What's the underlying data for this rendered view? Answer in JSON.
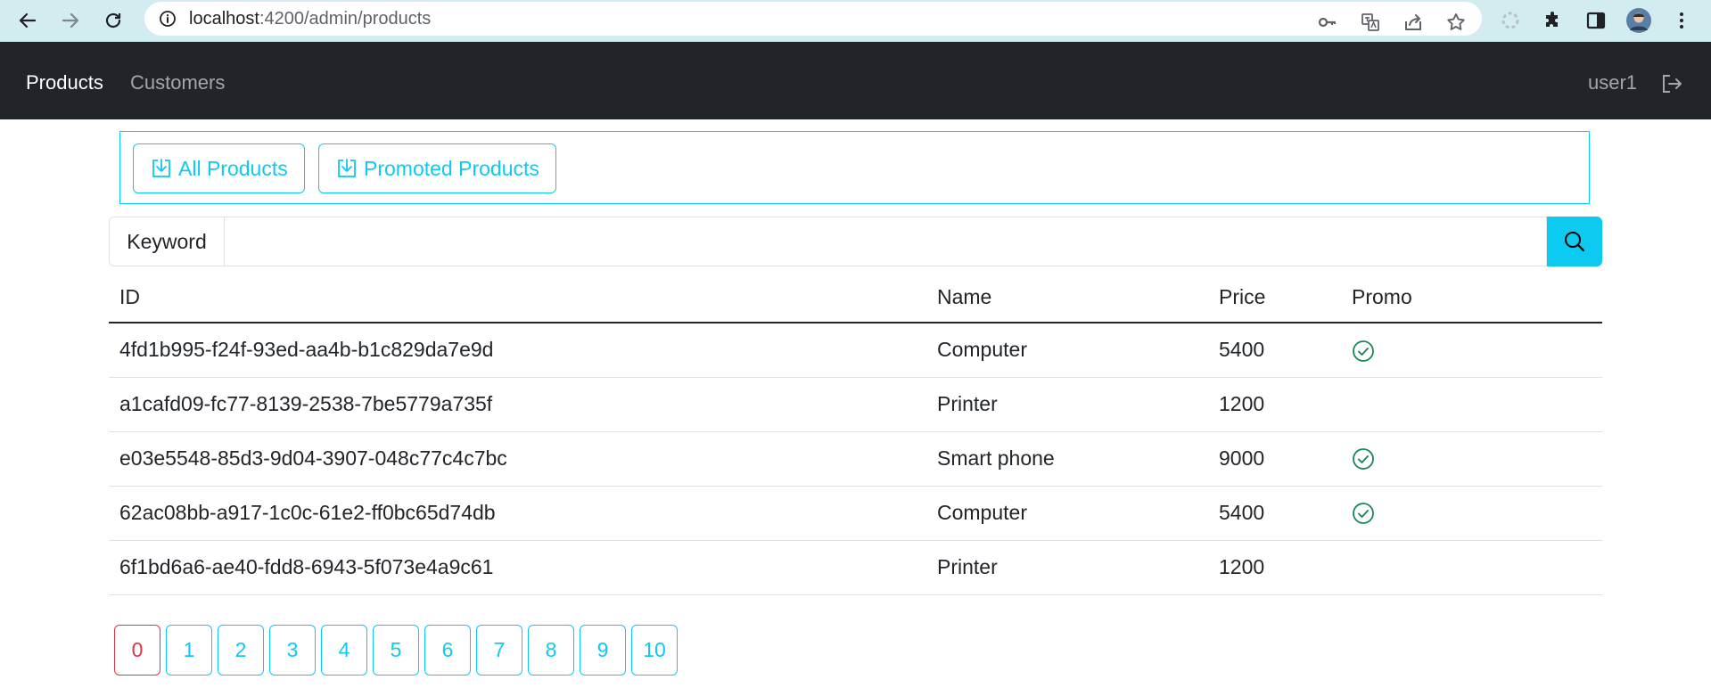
{
  "browser": {
    "url_host": "localhost",
    "url_rest": ":4200/admin/products"
  },
  "navbar": {
    "links": [
      {
        "label": "Products",
        "active": true
      },
      {
        "label": "Customers",
        "active": false
      }
    ],
    "user": "user1"
  },
  "filter": {
    "all_products_label": "All Products",
    "promoted_products_label": "Promoted Products"
  },
  "search": {
    "label": "Keyword",
    "value": "",
    "placeholder": ""
  },
  "table": {
    "headers": [
      "ID",
      "Name",
      "Price",
      "Promo"
    ],
    "rows": [
      {
        "id": "4fd1b995-f24f-93ed-aa4b-b1c829da7e9d",
        "name": "Computer",
        "price": "5400",
        "promo": true
      },
      {
        "id": "a1cafd09-fc77-8139-2538-7be5779a735f",
        "name": "Printer",
        "price": "1200",
        "promo": false
      },
      {
        "id": "e03e5548-85d3-9d04-3907-048c77c4c7bc",
        "name": "Smart phone",
        "price": "9000",
        "promo": true
      },
      {
        "id": "62ac08bb-a917-1c0c-61e2-ff0bc65d74db",
        "name": "Computer",
        "price": "5400",
        "promo": true
      },
      {
        "id": "6f1bd6a6-ae40-fdd8-6943-5f073e4a9c61",
        "name": "Printer",
        "price": "1200",
        "promo": false
      }
    ]
  },
  "pagination": {
    "pages": [
      "0",
      "1",
      "2",
      "3",
      "4",
      "5",
      "6",
      "7",
      "8",
      "9",
      "10"
    ],
    "current": "0"
  },
  "colors": {
    "accent": "#0dcaf0",
    "danger": "#dc3545",
    "success": "#198754",
    "navbar": "#212529"
  }
}
